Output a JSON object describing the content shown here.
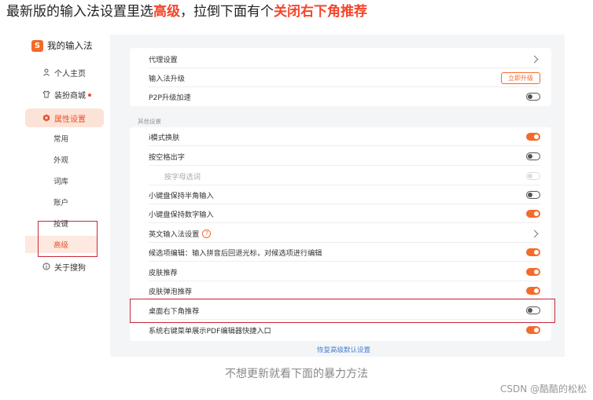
{
  "headline": {
    "part1": "最新版的输入法设置里选",
    "highlight1": "高级",
    "part2": "，拉倒下面有个",
    "highlight2": "关闭右下角推荐"
  },
  "sidebar": {
    "app_title": "我的输入法",
    "logo_char": "S",
    "items": [
      {
        "label": "个人主页",
        "icon": "person-icon"
      },
      {
        "label": "装扮商城",
        "icon": "shirt-icon",
        "badge": true
      },
      {
        "label": "属性设置",
        "icon": "settings-icon",
        "active": true
      }
    ],
    "subitems": [
      "常用",
      "外观",
      "词库",
      "账户",
      "按键",
      "高级"
    ],
    "selected_subitem": "高级",
    "about": {
      "label": "关于搜狗",
      "icon": "info-icon"
    }
  },
  "top_card": {
    "rows": [
      {
        "label": "代理设置",
        "control": "chevron"
      },
      {
        "label": "输入法升级",
        "control": "button",
        "button_label": "立即升级"
      },
      {
        "label": "P2P升级加速",
        "control": "toggle",
        "state": "off"
      }
    ]
  },
  "section_label": "其他设置",
  "other_card": {
    "rows": [
      {
        "label": "i模式换肤",
        "control": "toggle",
        "state": "on"
      },
      {
        "label": "按空格出字",
        "control": "toggle",
        "state": "off"
      },
      {
        "label": "按字母选词",
        "control": "toggle",
        "state": "disabled"
      },
      {
        "label": "小键盘保持半角输入",
        "control": "toggle",
        "state": "off"
      },
      {
        "label": "小键盘保持数字输入",
        "control": "toggle",
        "state": "on"
      },
      {
        "label": "英文输入法设置",
        "control": "chevron",
        "help": true
      },
      {
        "label": "候选项编辑：输入拼音后回退光标，对候选项进行编辑",
        "control": "toggle",
        "state": "on"
      },
      {
        "label": "皮肤推荐",
        "control": "toggle",
        "state": "on"
      },
      {
        "label": "皮肤弹泡推荐",
        "control": "toggle",
        "state": "on"
      },
      {
        "label": "桌面右下角推荐",
        "control": "toggle",
        "state": "off"
      },
      {
        "label": "系统右键菜单展示PDF编辑器快捷入口",
        "control": "toggle",
        "state": "on"
      }
    ]
  },
  "restore_link": "恢复高级默认设置",
  "caption": "不想更新就看下面的暴力方法",
  "watermark": "CSDN @酷酷的松松",
  "colors": {
    "accent": "#f46a2b",
    "highlight_text": "#f4462b",
    "annotation_box": "#c8293a",
    "link": "#4a7fd0"
  }
}
